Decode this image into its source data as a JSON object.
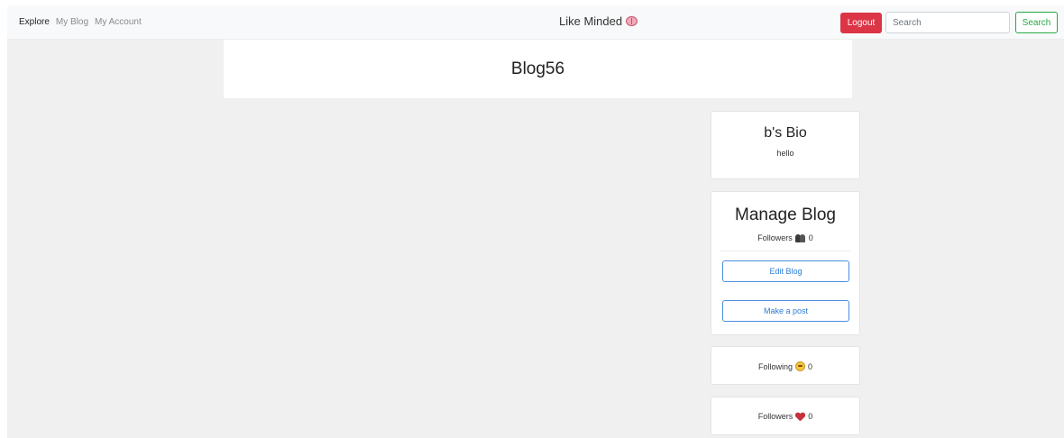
{
  "nav": {
    "links": [
      "Explore",
      "My Blog",
      "My Account"
    ],
    "brand": "Like Minded",
    "brand_icon": "brain-icon",
    "logout_label": "Logout",
    "search_placeholder": "Search",
    "search_label": "Search"
  },
  "header": {
    "title": "Blog56"
  },
  "bio": {
    "title": "b's Bio",
    "text": "hello"
  },
  "manage": {
    "title": "Manage Blog",
    "followers_label": "Followers",
    "followers_icon": "people-icon",
    "followers_count": "0",
    "edit_label": "Edit Blog",
    "post_label": "Make a post"
  },
  "following": {
    "label": "Following",
    "icon": "smiley-face-icon",
    "count": "0"
  },
  "followers": {
    "label": "Followers",
    "icon": "heart-icon",
    "count": "0"
  },
  "colors": {
    "danger": "#dc3545",
    "success": "#28a745",
    "primary": "#4a90e2",
    "page_bg": "#f0f0f0"
  }
}
